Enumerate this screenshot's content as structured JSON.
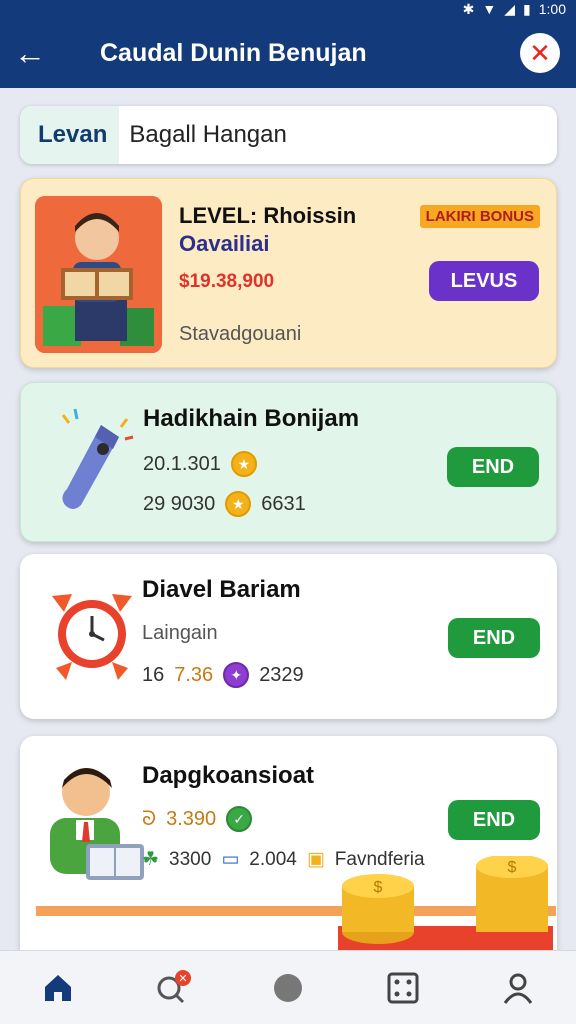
{
  "status": {
    "time": "1:00"
  },
  "header": {
    "title": "Caudal Dunin Benujan"
  },
  "search": {
    "tab_label": "Levan",
    "value": "Bagall Hangan"
  },
  "featured": {
    "title": "LEVEL: Rhoissin",
    "subtitle": "Oavailiai",
    "price": "$19.38,900",
    "caption": "Stavadgouani",
    "badge": "LAKIRI BONUS",
    "button": "LEVUS",
    "colors": {
      "button": "#6a32c9",
      "badge": "#f7a823"
    }
  },
  "items": [
    {
      "title": "Hadikhain Bonijam",
      "line1_value": "20.1.301",
      "line2_value": "29 9030",
      "line2_extra": "6631",
      "button": "END",
      "icon": "stapler-icon"
    },
    {
      "title": "Diavel Bariam",
      "caption": "Laingain",
      "line_prefix": "16",
      "line_value": "7.36",
      "line_extra": "2329",
      "button": "END",
      "icon": "alarm-clock-icon"
    },
    {
      "title": "Dapgkoansioat",
      "line1_value": "3.390",
      "line2_a": "3300",
      "line2_b": "2.004",
      "line2_c": "Favndferia",
      "button": "END",
      "icon": "person-reading-icon"
    }
  ],
  "colors": {
    "primary": "#133a7a",
    "accent_green": "#1f9a3d"
  }
}
